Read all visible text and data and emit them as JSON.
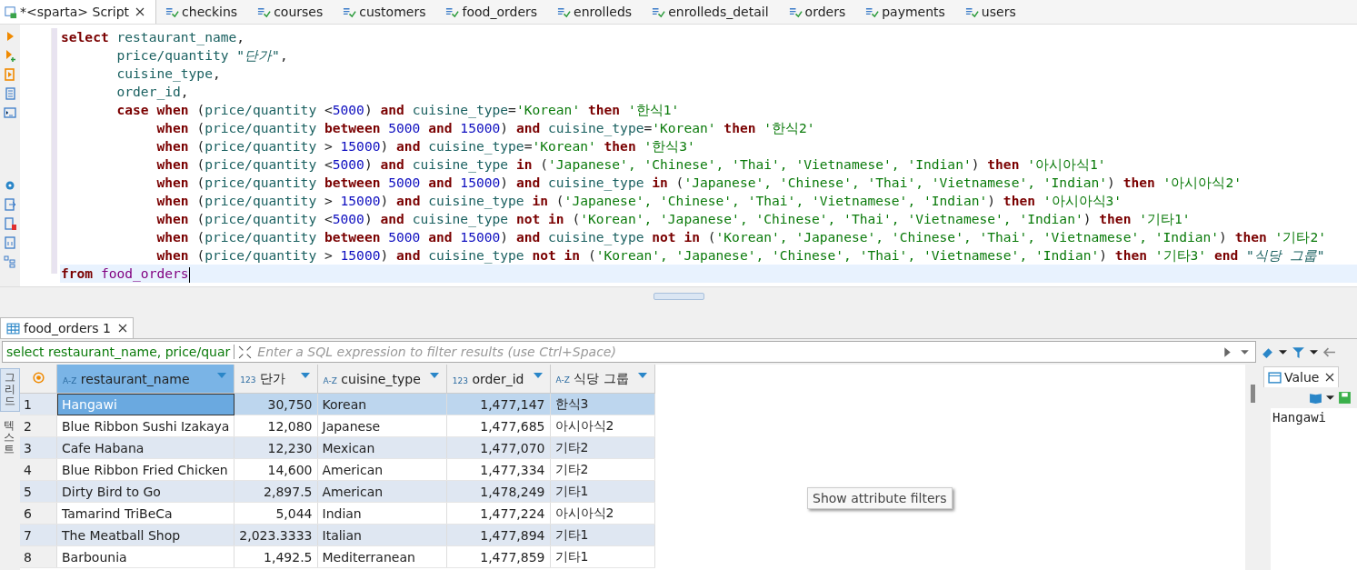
{
  "editor_tabs": [
    {
      "label": "*<sparta> Script",
      "kind": "script",
      "selected": true
    },
    {
      "label": "checkins",
      "kind": "table",
      "selected": false
    },
    {
      "label": "courses",
      "kind": "table",
      "selected": false
    },
    {
      "label": "customers",
      "kind": "table",
      "selected": false
    },
    {
      "label": "food_orders",
      "kind": "table",
      "selected": false
    },
    {
      "label": "enrolleds",
      "kind": "table",
      "selected": false
    },
    {
      "label": "enrolleds_detail",
      "kind": "table",
      "selected": false
    },
    {
      "label": "orders",
      "kind": "table",
      "selected": false
    },
    {
      "label": "payments",
      "kind": "table",
      "selected": false
    },
    {
      "label": "users",
      "kind": "table",
      "selected": false
    }
  ],
  "code_lines": [
    {
      "current": false,
      "tokens": [
        {
          "kind": "keyword",
          "text": "select"
        },
        {
          "kind": "ident",
          "text": " restaurant_name"
        },
        {
          "kind": "punct",
          "text": ","
        }
      ]
    },
    {
      "current": false,
      "tokens": [
        {
          "kind": "ident",
          "text": "       price/quantity "
        },
        {
          "kind": "alias",
          "text": "\"단가\""
        },
        {
          "kind": "punct",
          "text": ","
        }
      ]
    },
    {
      "current": false,
      "tokens": [
        {
          "kind": "ident",
          "text": "       cuisine_type"
        },
        {
          "kind": "punct",
          "text": ","
        }
      ]
    },
    {
      "current": false,
      "tokens": [
        {
          "kind": "ident",
          "text": "       order_id"
        },
        {
          "kind": "punct",
          "text": ","
        }
      ]
    },
    {
      "current": false,
      "tokens": [
        {
          "kind": "keyword",
          "text": "       case when"
        },
        {
          "kind": "punct",
          "text": " ("
        },
        {
          "kind": "ident",
          "text": "price/quantity "
        },
        {
          "kind": "punct",
          "text": "<"
        },
        {
          "kind": "number",
          "text": "5000"
        },
        {
          "kind": "punct",
          "text": ") "
        },
        {
          "kind": "keyword",
          "text": "and"
        },
        {
          "kind": "ident",
          "text": " cuisine_type"
        },
        {
          "kind": "punct",
          "text": "="
        },
        {
          "kind": "string",
          "text": "'Korean'"
        },
        {
          "kind": "keyword",
          "text": " then "
        },
        {
          "kind": "string",
          "text": "'한식1'"
        }
      ]
    },
    {
      "current": false,
      "tokens": [
        {
          "kind": "keyword",
          "text": "            when"
        },
        {
          "kind": "punct",
          "text": " ("
        },
        {
          "kind": "ident",
          "text": "price/quantity "
        },
        {
          "kind": "keyword",
          "text": "between "
        },
        {
          "kind": "number",
          "text": "5000 "
        },
        {
          "kind": "keyword",
          "text": "and "
        },
        {
          "kind": "number",
          "text": "15000"
        },
        {
          "kind": "punct",
          "text": ") "
        },
        {
          "kind": "keyword",
          "text": "and"
        },
        {
          "kind": "ident",
          "text": " cuisine_type"
        },
        {
          "kind": "punct",
          "text": "="
        },
        {
          "kind": "string",
          "text": "'Korean'"
        },
        {
          "kind": "keyword",
          "text": " then "
        },
        {
          "kind": "string",
          "text": "'한식2'"
        }
      ]
    },
    {
      "current": false,
      "tokens": [
        {
          "kind": "keyword",
          "text": "            when"
        },
        {
          "kind": "punct",
          "text": " ("
        },
        {
          "kind": "ident",
          "text": "price/quantity "
        },
        {
          "kind": "punct",
          "text": "> "
        },
        {
          "kind": "number",
          "text": "15000"
        },
        {
          "kind": "punct",
          "text": ") "
        },
        {
          "kind": "keyword",
          "text": "and"
        },
        {
          "kind": "ident",
          "text": " cuisine_type"
        },
        {
          "kind": "punct",
          "text": "="
        },
        {
          "kind": "string",
          "text": "'Korean'"
        },
        {
          "kind": "keyword",
          "text": " then "
        },
        {
          "kind": "string",
          "text": "'한식3'"
        }
      ]
    },
    {
      "current": false,
      "tokens": [
        {
          "kind": "keyword",
          "text": "            when"
        },
        {
          "kind": "punct",
          "text": " ("
        },
        {
          "kind": "ident",
          "text": "price/quantity "
        },
        {
          "kind": "punct",
          "text": "<"
        },
        {
          "kind": "number",
          "text": "5000"
        },
        {
          "kind": "punct",
          "text": ") "
        },
        {
          "kind": "keyword",
          "text": "and"
        },
        {
          "kind": "ident",
          "text": " cuisine_type "
        },
        {
          "kind": "keyword",
          "text": "in"
        },
        {
          "kind": "punct",
          "text": " ("
        },
        {
          "kind": "string",
          "text": "'Japanese', 'Chinese', 'Thai', 'Vietnamese', 'Indian'"
        },
        {
          "kind": "punct",
          "text": ") "
        },
        {
          "kind": "keyword",
          "text": "then "
        },
        {
          "kind": "string",
          "text": "'아시아식1'"
        }
      ]
    },
    {
      "current": false,
      "tokens": [
        {
          "kind": "keyword",
          "text": "            when"
        },
        {
          "kind": "punct",
          "text": " ("
        },
        {
          "kind": "ident",
          "text": "price/quantity "
        },
        {
          "kind": "keyword",
          "text": "between "
        },
        {
          "kind": "number",
          "text": "5000 "
        },
        {
          "kind": "keyword",
          "text": "and "
        },
        {
          "kind": "number",
          "text": "15000"
        },
        {
          "kind": "punct",
          "text": ") "
        },
        {
          "kind": "keyword",
          "text": "and"
        },
        {
          "kind": "ident",
          "text": " cuisine_type "
        },
        {
          "kind": "keyword",
          "text": "in"
        },
        {
          "kind": "punct",
          "text": " ("
        },
        {
          "kind": "string",
          "text": "'Japanese', 'Chinese', 'Thai', 'Vietnamese', 'Indian'"
        },
        {
          "kind": "punct",
          "text": ") "
        },
        {
          "kind": "keyword",
          "text": "then "
        },
        {
          "kind": "string",
          "text": "'아시아식2'"
        }
      ]
    },
    {
      "current": false,
      "tokens": [
        {
          "kind": "keyword",
          "text": "            when"
        },
        {
          "kind": "punct",
          "text": " ("
        },
        {
          "kind": "ident",
          "text": "price/quantity "
        },
        {
          "kind": "punct",
          "text": "> "
        },
        {
          "kind": "number",
          "text": "15000"
        },
        {
          "kind": "punct",
          "text": ") "
        },
        {
          "kind": "keyword",
          "text": "and"
        },
        {
          "kind": "ident",
          "text": " cuisine_type "
        },
        {
          "kind": "keyword",
          "text": "in"
        },
        {
          "kind": "punct",
          "text": " ("
        },
        {
          "kind": "string",
          "text": "'Japanese', 'Chinese', 'Thai', 'Vietnamese', 'Indian'"
        },
        {
          "kind": "punct",
          "text": ") "
        },
        {
          "kind": "keyword",
          "text": "then "
        },
        {
          "kind": "string",
          "text": "'아시아식3'"
        }
      ]
    },
    {
      "current": false,
      "tokens": [
        {
          "kind": "keyword",
          "text": "            when"
        },
        {
          "kind": "punct",
          "text": " ("
        },
        {
          "kind": "ident",
          "text": "price/quantity "
        },
        {
          "kind": "punct",
          "text": "<"
        },
        {
          "kind": "number",
          "text": "5000"
        },
        {
          "kind": "punct",
          "text": ") "
        },
        {
          "kind": "keyword",
          "text": "and"
        },
        {
          "kind": "ident",
          "text": " cuisine_type "
        },
        {
          "kind": "keyword",
          "text": "not in"
        },
        {
          "kind": "punct",
          "text": " ("
        },
        {
          "kind": "string",
          "text": "'Korean', 'Japanese', 'Chinese', 'Thai', 'Vietnamese', 'Indian'"
        },
        {
          "kind": "punct",
          "text": ") "
        },
        {
          "kind": "keyword",
          "text": "then "
        },
        {
          "kind": "string",
          "text": "'기타1'"
        }
      ]
    },
    {
      "current": false,
      "tokens": [
        {
          "kind": "keyword",
          "text": "            when"
        },
        {
          "kind": "punct",
          "text": " ("
        },
        {
          "kind": "ident",
          "text": "price/quantity "
        },
        {
          "kind": "keyword",
          "text": "between "
        },
        {
          "kind": "number",
          "text": "5000 "
        },
        {
          "kind": "keyword",
          "text": "and "
        },
        {
          "kind": "number",
          "text": "15000"
        },
        {
          "kind": "punct",
          "text": ") "
        },
        {
          "kind": "keyword",
          "text": "and"
        },
        {
          "kind": "ident",
          "text": " cuisine_type "
        },
        {
          "kind": "keyword",
          "text": "not in"
        },
        {
          "kind": "punct",
          "text": " ("
        },
        {
          "kind": "string",
          "text": "'Korean', 'Japanese', 'Chinese', 'Thai', 'Vietnamese', 'Indian'"
        },
        {
          "kind": "punct",
          "text": ") "
        },
        {
          "kind": "keyword",
          "text": "then "
        },
        {
          "kind": "string",
          "text": "'기타2'"
        }
      ]
    },
    {
      "current": false,
      "tokens": [
        {
          "kind": "keyword",
          "text": "            when"
        },
        {
          "kind": "punct",
          "text": " ("
        },
        {
          "kind": "ident",
          "text": "price/quantity "
        },
        {
          "kind": "punct",
          "text": "> "
        },
        {
          "kind": "number",
          "text": "15000"
        },
        {
          "kind": "punct",
          "text": ") "
        },
        {
          "kind": "keyword",
          "text": "and"
        },
        {
          "kind": "ident",
          "text": " cuisine_type "
        },
        {
          "kind": "keyword",
          "text": "not in"
        },
        {
          "kind": "punct",
          "text": " ("
        },
        {
          "kind": "string",
          "text": "'Korean', 'Japanese', 'Chinese', 'Thai', 'Vietnamese', 'Indian'"
        },
        {
          "kind": "punct",
          "text": ") "
        },
        {
          "kind": "keyword",
          "text": "then "
        },
        {
          "kind": "string",
          "text": "'기타3'"
        },
        {
          "kind": "keyword",
          "text": " end "
        },
        {
          "kind": "alias",
          "text": "\"식당 그룹\""
        }
      ]
    },
    {
      "current": true,
      "tokens": [
        {
          "kind": "keyword",
          "text": "from "
        },
        {
          "kind": "table",
          "text": "food_orders"
        }
      ]
    }
  ],
  "results_tab": {
    "label": "food_orders 1"
  },
  "query_preview": "select restaurant_name, price/quar",
  "filter": {
    "placeholder": "Enter a SQL expression to filter results (use Ctrl+Space)"
  },
  "side_tabs": [
    {
      "label": "그리드",
      "selected": true
    },
    {
      "label": "텍스트",
      "selected": false
    }
  ],
  "columns": [
    {
      "type_label": "A-Z",
      "name": "restaurant_name",
      "kind": "text",
      "selected": true
    },
    {
      "type_label": "123",
      "name": "단가",
      "kind": "number",
      "selected": false
    },
    {
      "type_label": "A-Z",
      "name": "cuisine_type",
      "kind": "text",
      "selected": false
    },
    {
      "type_label": "123",
      "name": "order_id",
      "kind": "number",
      "selected": false
    },
    {
      "type_label": "A-Z",
      "name": "식당 그룹",
      "kind": "text",
      "selected": false
    }
  ],
  "rows": [
    {
      "num": "1",
      "selected": true,
      "cells": [
        "Hangawi",
        "30,750",
        "Korean",
        "1,477,147",
        "한식3"
      ]
    },
    {
      "num": "2",
      "selected": false,
      "cells": [
        "Blue Ribbon Sushi Izakaya",
        "12,080",
        "Japanese",
        "1,477,685",
        "아시아식2"
      ]
    },
    {
      "num": "3",
      "selected": false,
      "cells": [
        "Cafe Habana",
        "12,230",
        "Mexican",
        "1,477,070",
        "기타2"
      ]
    },
    {
      "num": "4",
      "selected": false,
      "cells": [
        "Blue Ribbon Fried Chicken",
        "14,600",
        "American",
        "1,477,334",
        "기타2"
      ]
    },
    {
      "num": "5",
      "selected": false,
      "cells": [
        "Dirty Bird to Go",
        "2,897.5",
        "American",
        "1,478,249",
        "기타1"
      ]
    },
    {
      "num": "6",
      "selected": false,
      "cells": [
        "Tamarind TriBeCa",
        "5,044",
        "Indian",
        "1,477,224",
        "아시아식2"
      ]
    },
    {
      "num": "7",
      "selected": false,
      "cells": [
        "The Meatball Shop",
        "2,023.3333",
        "Italian",
        "1,477,894",
        "기타1"
      ]
    },
    {
      "num": "8",
      "selected": false,
      "cells": [
        "Barbounia",
        "1,492.5",
        "Mediterranean",
        "1,477,859",
        "기타1"
      ]
    }
  ],
  "tooltip": "Show attribute filters",
  "value_panel": {
    "title": "Value",
    "value": "Hangawi"
  }
}
